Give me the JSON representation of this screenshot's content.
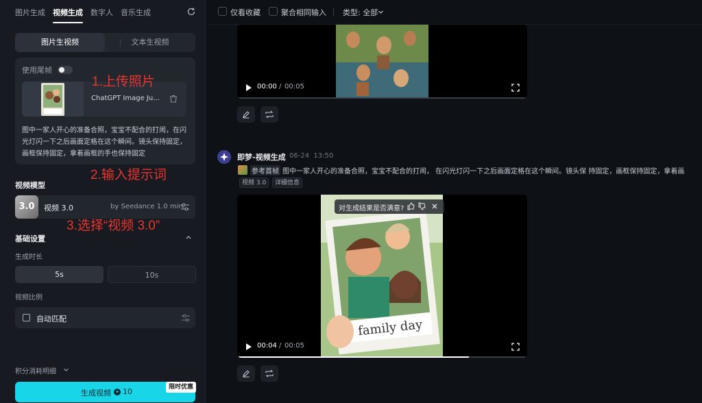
{
  "top_tabs": [
    "图片生成",
    "视频生成",
    "数字人",
    "音乐生成"
  ],
  "sub_tabs": [
    "图片生视频",
    "文本生视频"
  ],
  "upload": {
    "toggle_label": "使用尾帧",
    "file_name": "ChatGPT Image Ju...",
    "prompt": "图中一家人开心的准备合照，宝宝不配合的打闹，在闪光灯闪一下之后画面定格在这个瞬间。镜头保持固定，画框保持固定，拿着画框的手也保持固定"
  },
  "model_section": {
    "title": "视频模型",
    "badge": "3.0",
    "name": "视频 3.0",
    "by": "by Seedance 1.0 mini"
  },
  "basic": {
    "title": "基础设置",
    "duration_label": "生成时长",
    "durations": [
      "5s",
      "10s"
    ],
    "selected_duration": "5s",
    "ratio_label": "视频比例",
    "ratio_value": "自动匹配"
  },
  "footer": {
    "cost_label": "积分消耗明细",
    "generate_label": "生成视频",
    "generate_cost": "10",
    "promo": "限时优惠"
  },
  "annotations": {
    "step1": "1.上传照片",
    "step2": "2.输入提示词",
    "step3": "3.选择“视频 3.0”"
  },
  "filters": {
    "favorites": "仅看收藏",
    "merge": "聚合相同输入",
    "type": "类型: 全部"
  },
  "video1": {
    "current": "00:00",
    "total": "00:05"
  },
  "message": {
    "name": "即梦-视频生成",
    "date": "06-24",
    "time": "13:50",
    "ref_label": "参考首帧",
    "text": "图中一家人开心的准备合照，宝宝不配合的打闹， 在闪光灯闪一下之后画面定格在这个瞬间。镜头保 持固定，画框保持固定，拿着画",
    "tags": [
      "视频 3.0",
      "详细信息"
    ],
    "satisfaction": "对生成结果是否满意?"
  },
  "video2": {
    "current": "00:04",
    "total": "00:05",
    "frame_text": "family day",
    "progress": 0.8
  },
  "colors": {
    "accent": "#18d6e8",
    "annotation": "#e8362f",
    "background": "#0e1116"
  }
}
